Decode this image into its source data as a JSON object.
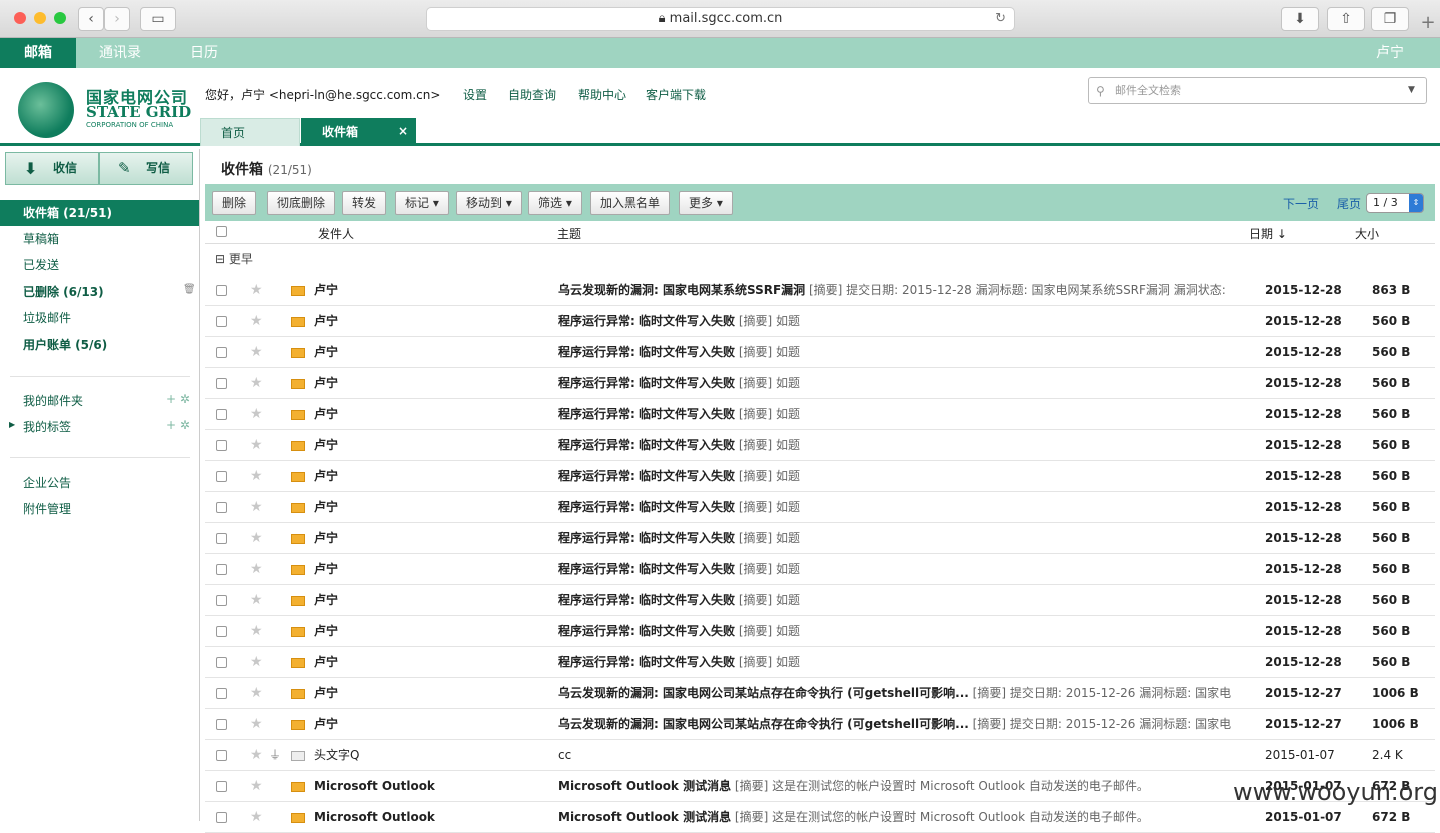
{
  "browser": {
    "url": "mail.sgcc.com.cn"
  },
  "nav": {
    "items": [
      "邮箱",
      "通讯录",
      "日历"
    ],
    "user": "卢宁"
  },
  "logo": {
    "cn": "国家电网公司",
    "en": "STATE GRID",
    "sub": "CORPORATION OF CHINA"
  },
  "header": {
    "greeting": "您好，卢宁 <hepri-ln@he.sgcc.com.cn>",
    "links": [
      "设置",
      "自助查询",
      "帮助中心",
      "客户端下载"
    ],
    "search_placeholder": "邮件全文检索",
    "tabs": [
      "首页",
      "收件箱"
    ]
  },
  "sidebar": {
    "receive": "收信",
    "compose": "写信",
    "folders": [
      "收件箱 (21/51)",
      "草稿箱",
      "已发送",
      "已删除 (6/13)",
      "垃圾邮件",
      "用户账单 (5/6)"
    ],
    "my": [
      "我的邮件夹",
      "我的标签"
    ],
    "extra": [
      "企业公告",
      "附件管理"
    ]
  },
  "main": {
    "title": "收件箱",
    "count": "(21/51)",
    "toolbar": [
      "删除",
      "彻底删除",
      "转发",
      "标记 ▾",
      "移动到 ▾",
      "筛选 ▾",
      "加入黑名单",
      "更多 ▾"
    ],
    "next": "下一页",
    "last": "尾页",
    "page": "1 / 3",
    "cols": {
      "sender": "发件人",
      "subject": "主题",
      "date": "日期 ↓",
      "size": "大小"
    },
    "group": "⊟ 更早"
  },
  "emails": [
    {
      "from": "卢宁",
      "subject": "乌云发现新的漏洞: 国家电网某系统SSRF漏洞",
      "digest": "[摘要] 提交日期: 2015-12-28 漏洞标题: 国家电网某系统SSRF漏洞 漏洞状态:",
      "date": "2015-12-28",
      "size": "863 B",
      "unread": true
    },
    {
      "from": "卢宁",
      "subject": "程序运行异常: 临时文件写入失败",
      "digest": "[摘要] 如题",
      "date": "2015-12-28",
      "size": "560 B",
      "unread": true
    },
    {
      "from": "卢宁",
      "subject": "程序运行异常: 临时文件写入失败",
      "digest": "[摘要] 如题",
      "date": "2015-12-28",
      "size": "560 B",
      "unread": true
    },
    {
      "from": "卢宁",
      "subject": "程序运行异常: 临时文件写入失败",
      "digest": "[摘要] 如题",
      "date": "2015-12-28",
      "size": "560 B",
      "unread": true
    },
    {
      "from": "卢宁",
      "subject": "程序运行异常: 临时文件写入失败",
      "digest": "[摘要] 如题",
      "date": "2015-12-28",
      "size": "560 B",
      "unread": true
    },
    {
      "from": "卢宁",
      "subject": "程序运行异常: 临时文件写入失败",
      "digest": "[摘要] 如题",
      "date": "2015-12-28",
      "size": "560 B",
      "unread": true
    },
    {
      "from": "卢宁",
      "subject": "程序运行异常: 临时文件写入失败",
      "digest": "[摘要] 如题",
      "date": "2015-12-28",
      "size": "560 B",
      "unread": true
    },
    {
      "from": "卢宁",
      "subject": "程序运行异常: 临时文件写入失败",
      "digest": "[摘要] 如题",
      "date": "2015-12-28",
      "size": "560 B",
      "unread": true
    },
    {
      "from": "卢宁",
      "subject": "程序运行异常: 临时文件写入失败",
      "digest": "[摘要] 如题",
      "date": "2015-12-28",
      "size": "560 B",
      "unread": true
    },
    {
      "from": "卢宁",
      "subject": "程序运行异常: 临时文件写入失败",
      "digest": "[摘要] 如题",
      "date": "2015-12-28",
      "size": "560 B",
      "unread": true
    },
    {
      "from": "卢宁",
      "subject": "程序运行异常: 临时文件写入失败",
      "digest": "[摘要] 如题",
      "date": "2015-12-28",
      "size": "560 B",
      "unread": true
    },
    {
      "from": "卢宁",
      "subject": "程序运行异常: 临时文件写入失败",
      "digest": "[摘要] 如题",
      "date": "2015-12-28",
      "size": "560 B",
      "unread": true
    },
    {
      "from": "卢宁",
      "subject": "程序运行异常: 临时文件写入失败",
      "digest": "[摘要] 如题",
      "date": "2015-12-28",
      "size": "560 B",
      "unread": true
    },
    {
      "from": "卢宁",
      "subject": "乌云发现新的漏洞: 国家电网公司某站点存在命令执行 (可getshell可影响...",
      "digest": "[摘要] 提交日期: 2015-12-26 漏洞标题: 国家电",
      "date": "2015-12-27",
      "size": "1006 B",
      "unread": true
    },
    {
      "from": "卢宁",
      "subject": "乌云发现新的漏洞: 国家电网公司某站点存在命令执行 (可getshell可影响...",
      "digest": "[摘要] 提交日期: 2015-12-26 漏洞标题: 国家电",
      "date": "2015-12-27",
      "size": "1006 B",
      "unread": true
    },
    {
      "from": "头文字Q",
      "subject": "cc",
      "digest": "",
      "date": "2015-01-07",
      "size": "2.4 K",
      "unread": false
    },
    {
      "from": "Microsoft Outlook",
      "subject": "Microsoft Outlook 测试消息",
      "digest": "[摘要] 这是在测试您的帐户设置时 Microsoft Outlook 自动发送的电子邮件。",
      "date": "2015-01-07",
      "size": "672 B",
      "unread": true
    },
    {
      "from": "Microsoft Outlook",
      "subject": "Microsoft Outlook 测试消息",
      "digest": "[摘要] 这是在测试您的帐户设置时 Microsoft Outlook 自动发送的电子邮件。",
      "date": "2015-01-07",
      "size": "672 B",
      "unread": true
    }
  ],
  "watermark": "www.wooyun.org"
}
